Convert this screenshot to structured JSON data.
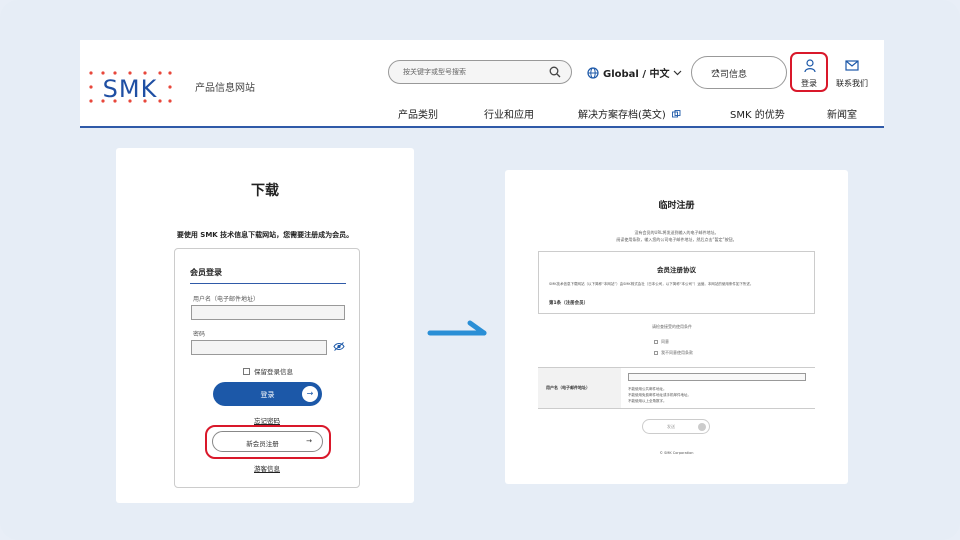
{
  "header": {
    "logo_text": "SMK",
    "site_name": "产品信息网站",
    "search_placeholder": "按关键字或型号搜索",
    "language": "Global / 中文",
    "company_info": "公司信息",
    "login": "登录",
    "contact": "联系我们",
    "nav": [
      "产品类别",
      "行业和应用",
      "解决方案存档(英文)",
      "SMK 的优势",
      "新闻室"
    ]
  },
  "download_page": {
    "title": "下载",
    "message": "要使用 SMK 技术信息下载网站，您需要注册成为会员。",
    "member_login_title": "会员登录",
    "username_label": "用户名（电子邮件地址）",
    "password_label": "密码",
    "remember_label": "保留登录信息",
    "login_button": "登录",
    "forgot_password": "忘记密码",
    "register_button": "新会员注册",
    "guest_info": "游客信息"
  },
  "temp_registration": {
    "title": "临时注册",
    "intro_line1": "没有会员的URL将发送到输入的电子邮件地址。",
    "intro_line2": "阅读使用条款，输入您的公司电子邮件地址，然后点击“暂定”按钮。",
    "agreement_title": "会员注册协议",
    "agreement_text": "SMK技术信息下载网站（以下简称“本网站”）由SMK株式会社（日本公司，以下简称“本公司”）运营。本网站的使用条件如下所述。",
    "agreement_section": "第1条（注册会员）",
    "agree_prompt": "请检查接受的使用条件",
    "agree_option": "同意",
    "disagree_option": "我不同意使用条款",
    "email_label": "用户名（电子邮件地址）",
    "note1": "不能使用公共邮件地址。",
    "note2": "不能使用免费邮件地址或手机邮件地址。",
    "note3": "不能使用以上全角数字。",
    "send_button": "发送",
    "copyright": "© SMK Corporation"
  }
}
